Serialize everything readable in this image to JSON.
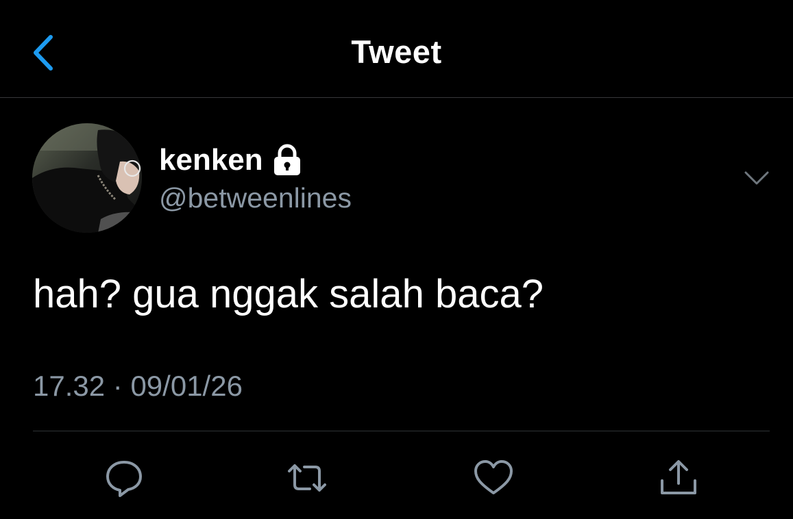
{
  "header": {
    "title": "Tweet",
    "back_icon": "chevron-left-icon",
    "accent_color": "#1d9bf0"
  },
  "tweet": {
    "author": {
      "display_name": "kenken",
      "handle": "@betweenlines",
      "protected_icon": "lock-icon"
    },
    "text": "hah? gua nggak salah baca?",
    "time": "17.32",
    "separator": "·",
    "date": "09/01/26",
    "more_icon": "chevron-down-icon"
  },
  "actions": [
    {
      "name": "reply",
      "icon": "speech-bubble-icon"
    },
    {
      "name": "retweet",
      "icon": "retweet-arrows-icon"
    },
    {
      "name": "like",
      "icon": "heart-icon"
    },
    {
      "name": "share",
      "icon": "share-upload-icon"
    }
  ],
  "colors": {
    "background": "#000000",
    "primary_text": "#ffffff",
    "secondary_text": "#8b98a5",
    "divider": "#2f3336"
  }
}
